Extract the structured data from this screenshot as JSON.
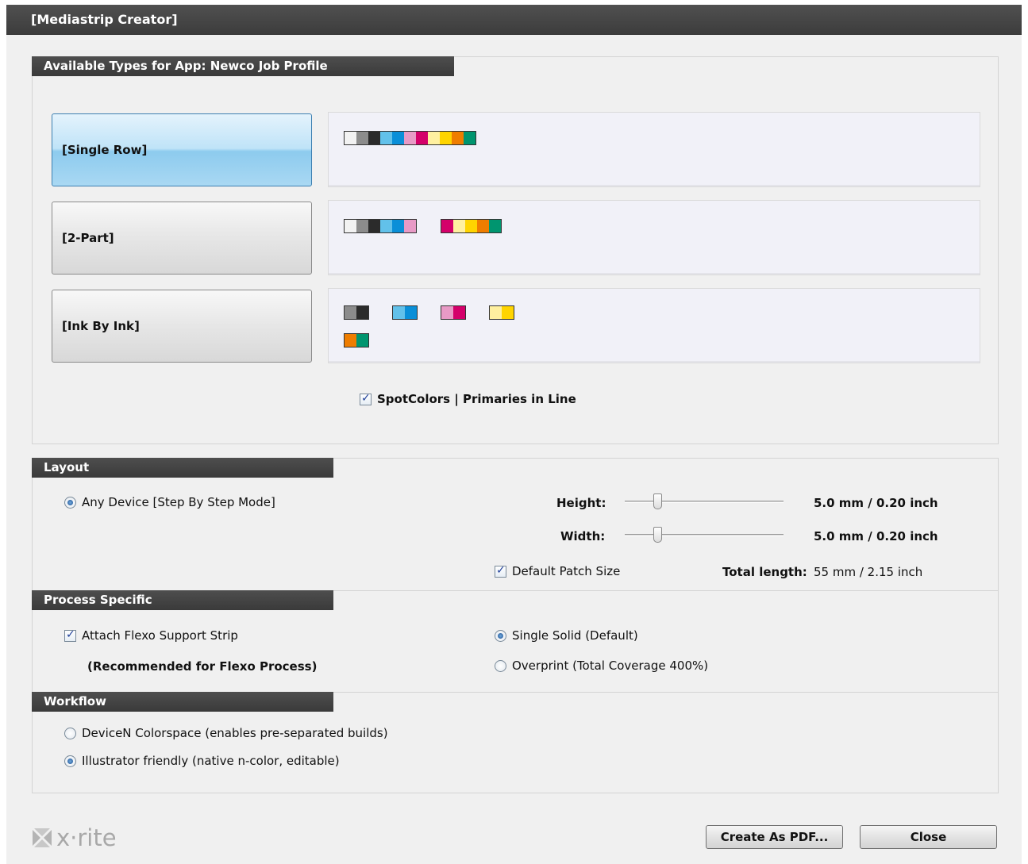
{
  "window": {
    "title": "[Mediastrip Creator]"
  },
  "types_panel": {
    "header": "Available Types for App: Newco Job Profile",
    "types": [
      {
        "label": "[Single Row]",
        "selected": true
      },
      {
        "label": "[2-Part]",
        "selected": false
      },
      {
        "label": "[Ink By Ink]",
        "selected": false
      }
    ],
    "spot_colors_label": "SpotColors | Primaries in Line",
    "spot_colors_checked": true
  },
  "patch_colors": {
    "white": "#f2f2f2",
    "gray": "#8c8c8c",
    "dark": "#2b2b2b",
    "cyan_light": "#62c1ea",
    "cyan": "#0a8fd8",
    "magenta_light": "#e89ac6",
    "magenta": "#d4006a",
    "yellow_light": "#fff0a0",
    "yellow": "#ffd400",
    "orange": "#ef7d00",
    "green": "#00956f"
  },
  "layout_panel": {
    "header": "Layout",
    "mode_label": "Any Device [Step By Step Mode]",
    "height_label": "Height:",
    "height_value": "5.0 mm / 0.20 inch",
    "width_label": "Width:",
    "width_value": "5.0 mm / 0.20 inch",
    "default_patch_label": "Default Patch Size",
    "total_length_label": "Total length:",
    "total_length_value": "55 mm / 2.15 inch"
  },
  "process_panel": {
    "header": "Process Specific",
    "attach_flexo_label": "Attach Flexo Support Strip",
    "recommended_note": "(Recommended for Flexo Process)",
    "single_solid_label": "Single Solid (Default)",
    "overprint_label": "Overprint (Total Coverage 400%)"
  },
  "workflow_panel": {
    "header": "Workflow",
    "devicen_label": "DeviceN Colorspace (enables pre-separated builds)",
    "illustrator_label": "Illustrator friendly (native n-color, editable)"
  },
  "footer": {
    "logo_text": "x·rite",
    "create_pdf_label": "Create As PDF...",
    "close_label": "Close"
  }
}
